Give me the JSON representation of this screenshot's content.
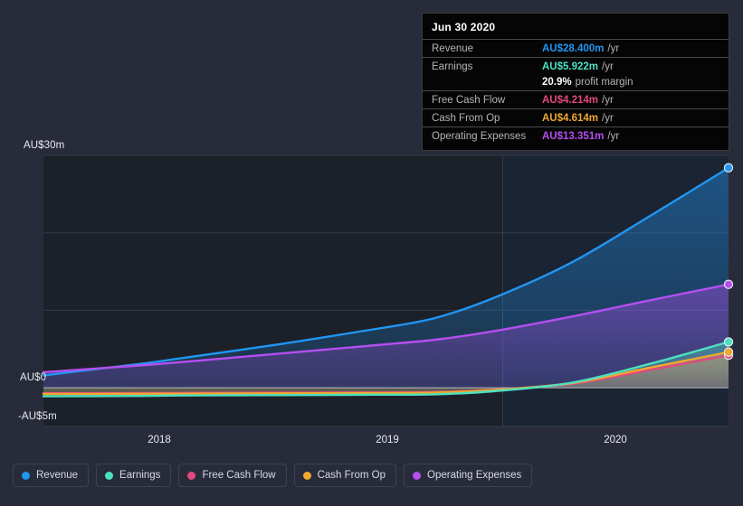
{
  "chart_data": {
    "type": "area",
    "title": "",
    "xlabel": "",
    "ylabel": "",
    "currency": "AU$",
    "units": "millions",
    "grid": true,
    "legend_position": "bottom",
    "ylim": [
      -5,
      30
    ],
    "y_ticks": [
      {
        "label": "AU$30m",
        "value": 30
      },
      {
        "label": "AU$0",
        "value": 0
      },
      {
        "label": "-AU$5m",
        "value": -5
      }
    ],
    "y_gridlines": [
      30,
      20,
      10,
      0,
      -5
    ],
    "x_ticks": [
      {
        "label": "2018",
        "value": 2018
      },
      {
        "label": "2019",
        "value": 2019
      },
      {
        "label": "2020",
        "value": 2020
      }
    ],
    "x_range": [
      2017.3,
      2020.8
    ],
    "forecast_boundary": 2019.3,
    "series": [
      {
        "name": "Revenue",
        "color": "#2196f3",
        "x": [
          2017.3,
          2017.8,
          2018.0,
          2018.5,
          2019.0,
          2019.3,
          2019.6,
          2020.0,
          2020.4,
          2020.8
        ],
        "values": [
          1.6,
          3.1,
          3.8,
          5.6,
          7.6,
          9.0,
          11.6,
          16.2,
          22.2,
          28.4
        ]
      },
      {
        "name": "Earnings",
        "color": "#4de0c0",
        "x": [
          2017.3,
          2017.8,
          2018.0,
          2018.5,
          2019.0,
          2019.3,
          2019.6,
          2020.0,
          2020.4,
          2020.8
        ],
        "values": [
          -1.1,
          -1.05,
          -1.0,
          -0.95,
          -0.9,
          -0.85,
          -0.45,
          0.65,
          3.1,
          5.92
        ]
      },
      {
        "name": "Free Cash Flow",
        "color": "#e2497f",
        "x": [
          2017.3,
          2017.8,
          2018.0,
          2018.5,
          2019.0,
          2019.3,
          2019.6,
          2020.0,
          2020.4,
          2020.8
        ],
        "values": [
          -0.7,
          -0.68,
          -0.66,
          -0.62,
          -0.6,
          -0.55,
          -0.25,
          0.5,
          2.3,
          4.21
        ]
      },
      {
        "name": "Cash From Op",
        "color": "#f0a830",
        "x": [
          2017.3,
          2017.8,
          2018.0,
          2018.5,
          2019.0,
          2019.3,
          2019.6,
          2020.0,
          2020.4,
          2020.8
        ],
        "values": [
          -0.8,
          -0.78,
          -0.76,
          -0.72,
          -0.68,
          -0.62,
          -0.3,
          0.6,
          2.6,
          4.61
        ]
      },
      {
        "name": "Operating Expenses",
        "color": "#b44ff0",
        "x": [
          2017.3,
          2017.8,
          2018.0,
          2018.5,
          2019.0,
          2019.3,
          2019.6,
          2020.0,
          2020.4,
          2020.8
        ],
        "values": [
          2.0,
          2.9,
          3.3,
          4.4,
          5.5,
          6.2,
          7.3,
          9.2,
          11.3,
          13.35
        ]
      }
    ]
  },
  "tooltip": {
    "date": "Jun 30 2020",
    "rows": [
      {
        "label": "Revenue",
        "value": "AU$28.400m",
        "unit": "/yr",
        "color": "#2196f3"
      },
      {
        "label": "Earnings",
        "value": "AU$5.922m",
        "unit": "/yr",
        "color": "#4de0c0"
      },
      {
        "label": "Free Cash Flow",
        "value": "AU$4.214m",
        "unit": "/yr",
        "color": "#e2497f"
      },
      {
        "label": "Cash From Op",
        "value": "AU$4.614m",
        "unit": "/yr",
        "color": "#f0a830"
      },
      {
        "label": "Operating Expenses",
        "value": "AU$13.351m",
        "unit": "/yr",
        "color": "#b44ff0"
      }
    ],
    "profit_margin": {
      "value": "20.9%",
      "label": "profit margin"
    }
  },
  "legend": {
    "items": [
      {
        "label": "Revenue",
        "color": "#2196f3"
      },
      {
        "label": "Earnings",
        "color": "#4de0c0"
      },
      {
        "label": "Free Cash Flow",
        "color": "#e2497f"
      },
      {
        "label": "Cash From Op",
        "color": "#f0a830"
      },
      {
        "label": "Operating Expenses",
        "color": "#b44ff0"
      }
    ]
  },
  "colors": {
    "page_background": "#282c3a",
    "plot_historical": "#1c2029",
    "plot_forecast": "#1b2433",
    "gridline": "#343b48",
    "zero_line": "#ced3dd",
    "axis_text": "#e8eaee"
  }
}
